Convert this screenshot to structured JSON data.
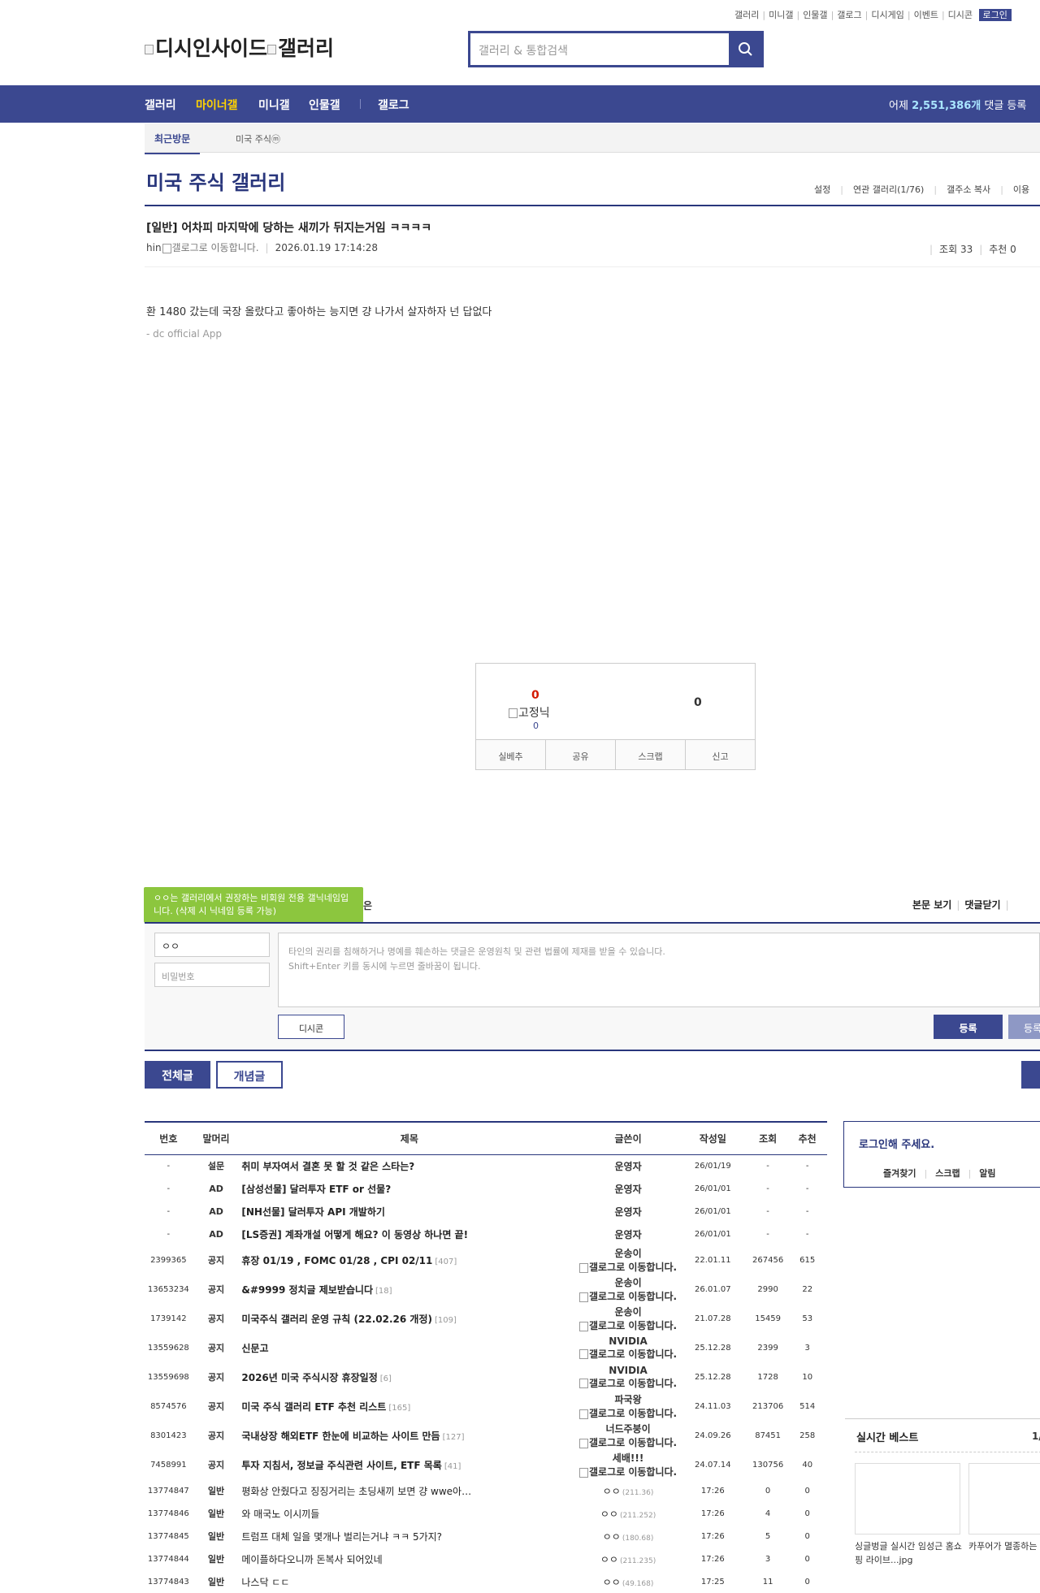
{
  "topnav": {
    "items": [
      "갤러리",
      "미니갤",
      "인물갤",
      "갤로그",
      "디시게임",
      "이벤트",
      "디시콘"
    ],
    "login": "로그인"
  },
  "logo": {
    "alt1": "디시인사이드",
    "alt2": "갤러리"
  },
  "search": {
    "placeholder": "갤러리 & 통합검색"
  },
  "gnb": {
    "items": [
      "갤러리",
      "마이너갤",
      "미니갤",
      "인물갤",
      "갤로그"
    ],
    "stat_prefix": "어제 ",
    "stat_count": "2,551,386개",
    "stat_suffix": " 댓글 등록"
  },
  "recent": {
    "label": "최근방문",
    "gallery": "미국 주식ⓜ"
  },
  "gallery": {
    "title": "미국 주식 갤러리",
    "options": [
      "설정",
      "연관 갤러리(1/76)",
      "갤주소 복사",
      "이용"
    ]
  },
  "post": {
    "title": "[일반] 어차피 마지막에 당하는 새끼가 뒤지는거임 ㅋㅋㅋㅋ",
    "author": "hin",
    "gallog_alt": "갤로그로 이동합니다.",
    "date": "2026.01.19 17:14:28",
    "views": "조회 33",
    "recommend": "추천 0",
    "body": "환 1480 갔는데 국장 올랐다고 좋아하는 능지면 걍 나가서 살자하자 넌 답없다",
    "source": "- dc official App"
  },
  "recommend_box": {
    "up": "0",
    "nick_alt": "고정닉",
    "fixed": "0",
    "down": "0",
    "buttons": [
      "실베추",
      "공유",
      "스크랩",
      "신고"
    ]
  },
  "comment": {
    "tooltip": "ㅇㅇ는 갤러리에서 권장하는 비회원 전용 갤닉네임입니다. (삭제 시 닉네임 등록 가능)",
    "tooltip_tail": "은",
    "view_body": "본문 보기",
    "close": "댓글닫기",
    "nick": "ㅇㅇ",
    "pw_placeholder": "비밀번호",
    "textarea1": "타인의 권리를 침해하거나 명예를 훼손하는 댓글은 운영원칙 및 관련 법률에 제재를 받을 수 있습니다.",
    "textarea2": "Shift+Enter 키를 동시에 누르면 줄바꿈이 됩니다.",
    "dccon": "디시콘",
    "submit": "등록",
    "submit2": "등록"
  },
  "tabs": {
    "all": "전체글",
    "concept": "개념글"
  },
  "list": {
    "headers": [
      "번호",
      "말머리",
      "제목",
      "글쓴이",
      "작성일",
      "조회",
      "추천"
    ],
    "rows": [
      {
        "no": "-",
        "head": "설문",
        "title": "취미 부자여서 결혼 못 할 것 같은 스타는?",
        "cc": "",
        "writer": "운영자",
        "gallog": "",
        "ip": "",
        "date": "26/01/19",
        "views": "-",
        "rec": "-"
      },
      {
        "no": "-",
        "head": "AD",
        "title": "[삼성선물] 달러투자 ETF or 선물?",
        "cc": "",
        "writer": "운영자",
        "gallog": "",
        "ip": "",
        "date": "26/01/01",
        "views": "-",
        "rec": "-"
      },
      {
        "no": "-",
        "head": "AD",
        "title": "[NH선물] 달러투자 API 개발하기",
        "cc": "",
        "writer": "운영자",
        "gallog": "",
        "ip": "",
        "date": "26/01/01",
        "views": "-",
        "rec": "-"
      },
      {
        "no": "-",
        "head": "AD",
        "title": "[LS증권] 계좌개설 어떻게 해요? 이 동영상 하나면 끝!",
        "cc": "",
        "writer": "운영자",
        "gallog": "",
        "ip": "",
        "date": "26/01/01",
        "views": "-",
        "rec": "-"
      },
      {
        "no": "2399365",
        "head": "공지",
        "title": "휴장 01/19 , FOMC 01/28 , CPI 02/11",
        "cc": "[407]",
        "writer": "운송이",
        "gallog": "갤로그로 이동합니다.",
        "ip": "",
        "date": "22.01.11",
        "views": "267456",
        "rec": "615"
      },
      {
        "no": "13653234",
        "head": "공지",
        "title": "&#9999 정치글 제보받습니다",
        "cc": "[18]",
        "writer": "운송이",
        "gallog": "갤로그로 이동합니다.",
        "ip": "",
        "date": "26.01.07",
        "views": "2990",
        "rec": "22"
      },
      {
        "no": "1739142",
        "head": "공지",
        "title": "미국주식 갤러리 운영 규칙 (22.02.26 개정)",
        "cc": "[109]",
        "writer": "운송이",
        "gallog": "갤로그로 이동합니다.",
        "ip": "",
        "date": "21.07.28",
        "views": "15459",
        "rec": "53"
      },
      {
        "no": "13559628",
        "head": "공지",
        "title": "신문고",
        "cc": "",
        "writer": "NVIDIA",
        "gallog": "갤로그로 이동합니다.",
        "ip": "",
        "date": "25.12.28",
        "views": "2399",
        "rec": "3"
      },
      {
        "no": "13559698",
        "head": "공지",
        "title": "2026년 미국 주식시장 휴장일정",
        "cc": "[6]",
        "writer": "NVIDIA",
        "gallog": "갤로그로 이동합니다.",
        "ip": "",
        "date": "25.12.28",
        "views": "1728",
        "rec": "10"
      },
      {
        "no": "8574576",
        "head": "공지",
        "title": "미국 주식 갤러리 ETF 추천 리스트",
        "cc": "[165]",
        "writer": "파국왕",
        "gallog": "갤로그로 이동합니다.",
        "ip": "",
        "date": "24.11.03",
        "views": "213706",
        "rec": "514"
      },
      {
        "no": "8301423",
        "head": "공지",
        "title": "국내상장 해외ETF 한눈에 비교하는 사이트 만듬",
        "cc": "[127]",
        "writer": "너드주붕이",
        "gallog": "갤로그로 이동합니다.",
        "ip": "",
        "date": "24.09.26",
        "views": "87451",
        "rec": "258"
      },
      {
        "no": "7458991",
        "head": "공지",
        "title": "투자 지침서, 정보글 주식관련 사이트, ETF 목록",
        "cc": "[41]",
        "writer": "세배!!!",
        "gallog": "갤로그로 이동합니다.",
        "ip": "",
        "date": "24.07.14",
        "views": "130756",
        "rec": "40"
      },
      {
        "no": "13774847",
        "head": "일반",
        "title": "평화상 안줬다고 징징거리는 초딩새끼 보면 걍 wwe아…",
        "cc": "",
        "writer": "ㅇㅇ",
        "gallog": "",
        "ip": "(211.36)",
        "date": "17:26",
        "views": "0",
        "rec": "0"
      },
      {
        "no": "13774846",
        "head": "일반",
        "title": "와 매국노 이시끼들",
        "cc": "",
        "writer": "ㅇㅇ",
        "gallog": "",
        "ip": "(211.252)",
        "date": "17:26",
        "views": "4",
        "rec": "0"
      },
      {
        "no": "13774845",
        "head": "일반",
        "title": "트럼프 대체 일을 몇개나 벌리는거냐 ㅋㅋ 5가지?",
        "cc": "",
        "writer": "ㅇㅇ",
        "gallog": "",
        "ip": "(180.68)",
        "date": "17:26",
        "views": "5",
        "rec": "0"
      },
      {
        "no": "13774844",
        "head": "일반",
        "title": "메이플하다오니까 돈복사 되어있네",
        "cc": "",
        "writer": "ㅇㅇ",
        "gallog": "",
        "ip": "(211.235)",
        "date": "17:26",
        "views": "3",
        "rec": "0"
      },
      {
        "no": "13774843",
        "head": "일반",
        "title": "나스닥 ㄷㄷ",
        "cc": "",
        "writer": "ㅇㅇ",
        "gallog": "",
        "ip": "(49.168)",
        "date": "17:25",
        "views": "11",
        "rec": "0"
      }
    ]
  },
  "login_panel": {
    "title": "로그인해 주세요.",
    "items": [
      "즐겨찾기",
      "스크랩",
      "알림"
    ]
  },
  "best": {
    "title": "실시간 베스트",
    "page": "1/",
    "items": [
      "싱글벙글 실시간 임성근 홈쇼핑 라이브...jpg",
      "카푸어가 멸종하는 이유"
    ]
  }
}
